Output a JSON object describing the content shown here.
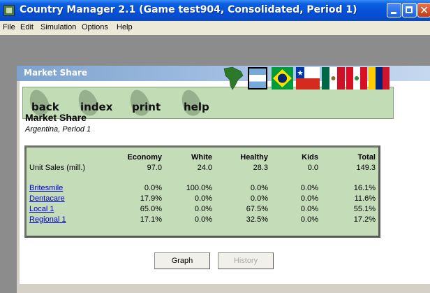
{
  "window": {
    "title": "Country Manager 2.1 (Game test904, Consolidated, Period 1)"
  },
  "menu": [
    "File",
    "Edit",
    "Simulation",
    "Options",
    "Help"
  ],
  "child_window": {
    "title": "Market Share"
  },
  "toolbar": {
    "back": "back",
    "index": "index",
    "print": "print",
    "help": "help",
    "flags": [
      "South America",
      "Argentina",
      "Brazil",
      "Chile",
      "Mexico",
      "Peru",
      "Venezuela"
    ]
  },
  "header": {
    "title": "Market Share",
    "subtitle": "Argentina, Period 1"
  },
  "table": {
    "columns": [
      "Economy",
      "White",
      "Healthy",
      "Kids",
      "Total"
    ],
    "unit_sales_label": "Unit Sales (mill.)",
    "unit_sales": [
      "97.0",
      "24.0",
      "28.3",
      "0.0",
      "149.3"
    ],
    "rows": [
      {
        "name": "Britesmile",
        "values": [
          "0.0%",
          "100.0%",
          "0.0%",
          "0.0%",
          "16.1%"
        ]
      },
      {
        "name": "Dentacare",
        "values": [
          "17.9%",
          "0.0%",
          "0.0%",
          "0.0%",
          "11.6%"
        ]
      },
      {
        "name": "Local 1",
        "values": [
          "65.0%",
          "0.0%",
          "67.5%",
          "0.0%",
          "55.1%"
        ]
      },
      {
        "name": "Regional 1",
        "values": [
          "17.1%",
          "0.0%",
          "32.5%",
          "0.0%",
          "17.2%"
        ]
      }
    ]
  },
  "buttons": {
    "graph": "Graph",
    "history": "History"
  },
  "colors": {
    "table_bg": "#c4dcb8",
    "toolbar_bg": "#c2dcb5",
    "link": "#0000cc",
    "title_bar": "#0550d8"
  }
}
